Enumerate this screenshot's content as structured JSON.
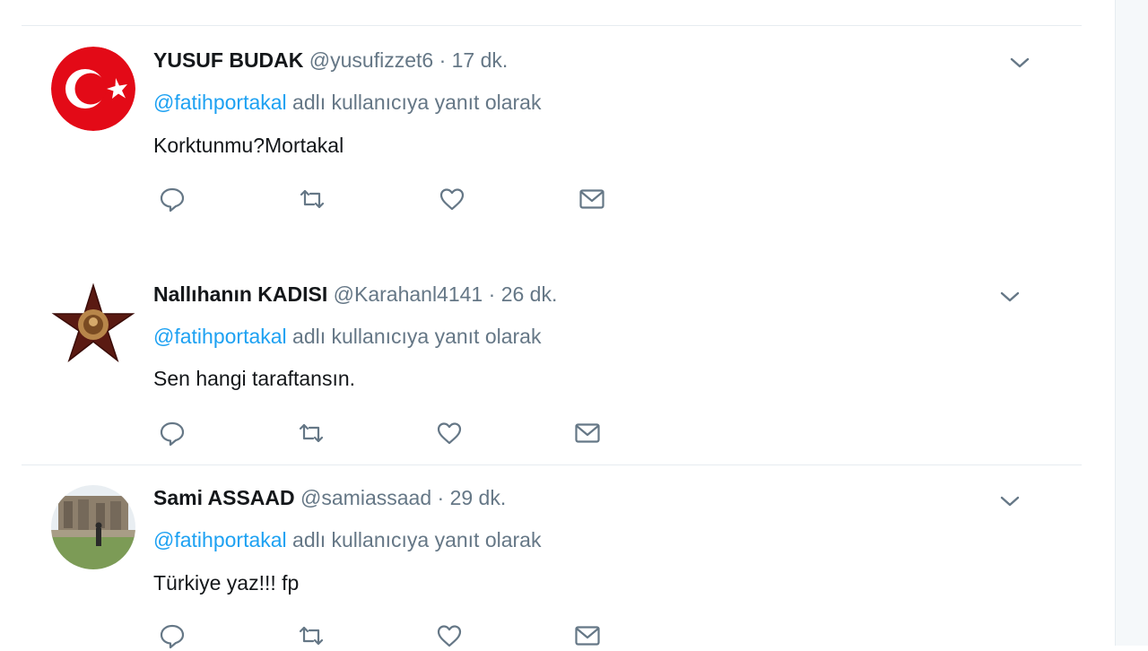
{
  "reply_prefix": "@fatihportakal",
  "reply_suffix": "adlı kullanıcıya yanıt olarak",
  "separator": "·",
  "tweets": [
    {
      "name": "YUSUF BUDAK",
      "handle": "@yusufizzet6",
      "time": "17 dk.",
      "text": "Korktunmu?Mortakal",
      "avatar": "turkish-flag"
    },
    {
      "name": "Nallıhanın KADISI",
      "handle": "@Karahanl4141",
      "time": "26 dk.",
      "text": "Sen hangi taraftansın.",
      "avatar": "medal-star"
    },
    {
      "name": "Sami ASSAAD",
      "handle": "@samiassaad",
      "time": "29 dk.",
      "text": "Türkiye yaz!!! fp",
      "avatar": "photo"
    }
  ],
  "icons": {
    "reply": "reply-icon",
    "retweet": "retweet-icon",
    "like": "like-icon",
    "message": "direct-message-icon",
    "more": "chevron-down-icon"
  },
  "colors": {
    "link": "#1da1f2",
    "secondary_text": "#657786",
    "primary_text": "#14171a",
    "flag_red": "#e30a17"
  }
}
